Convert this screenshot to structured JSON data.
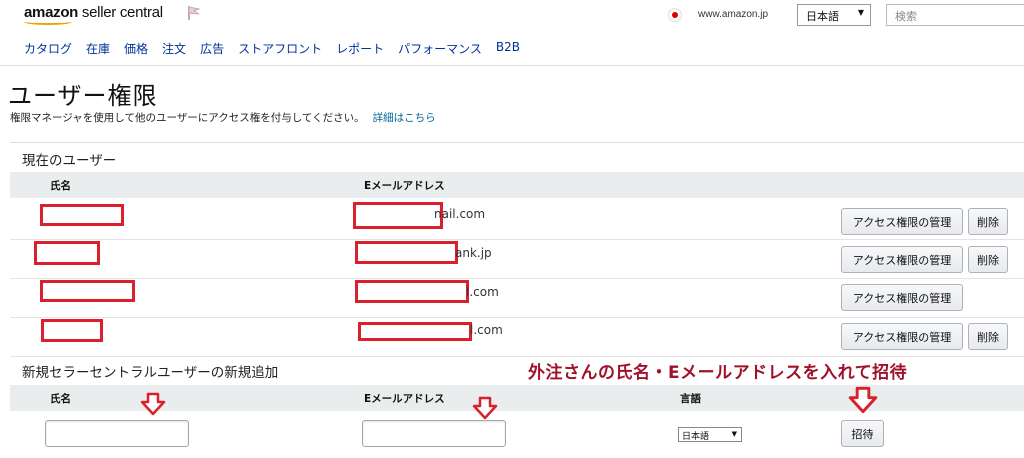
{
  "header": {
    "logo_bold": "amazon",
    "logo_light": " seller central",
    "marketplace": "www.amazon.jp",
    "language_selected": "日本語",
    "search_placeholder": "検索"
  },
  "nav": {
    "items": [
      "カタログ",
      "在庫",
      "価格",
      "注文",
      "広告",
      "ストアフロント",
      "レポート",
      "パフォーマンス",
      "B2B"
    ]
  },
  "page": {
    "title": "ユーザー権限",
    "subtitle": "権限マネージャを使用して他のユーザーにアクセス権を付与してください。",
    "details_link": "詳細はこちら"
  },
  "current_users": {
    "section_title": "現在のユーザー",
    "columns": {
      "name": "氏名",
      "email": "Eメールアドレス"
    },
    "rows": [
      {
        "email_visible": "nail.com",
        "manage_label": "アクセス権限の管理",
        "delete_label": "削除",
        "has_delete": true
      },
      {
        "email_visible": "ank.jp",
        "manage_label": "アクセス権限の管理",
        "delete_label": "削除",
        "has_delete": true
      },
      {
        "email_visible": "l.com",
        "manage_label": "アクセス権限の管理",
        "delete_label": "",
        "has_delete": false
      },
      {
        "email_visible": "l.com",
        "manage_label": "アクセス権限の管理",
        "delete_label": "削除",
        "has_delete": true
      }
    ]
  },
  "add_user": {
    "section_title": "新規セラーセントラルユーザーの新規追加",
    "columns": {
      "name": "氏名",
      "email": "Eメールアドレス",
      "language": "言語"
    },
    "language_selected": "日本語",
    "invite_label": "招待"
  },
  "annotation": {
    "text": "外注さんの氏名・Eメールアドレスを入れて招待",
    "color": "#a0112a"
  },
  "colors": {
    "redaction": "#d9202c",
    "link": "#006699",
    "nav_link": "#003399",
    "table_header_bg": "#eaeded"
  }
}
